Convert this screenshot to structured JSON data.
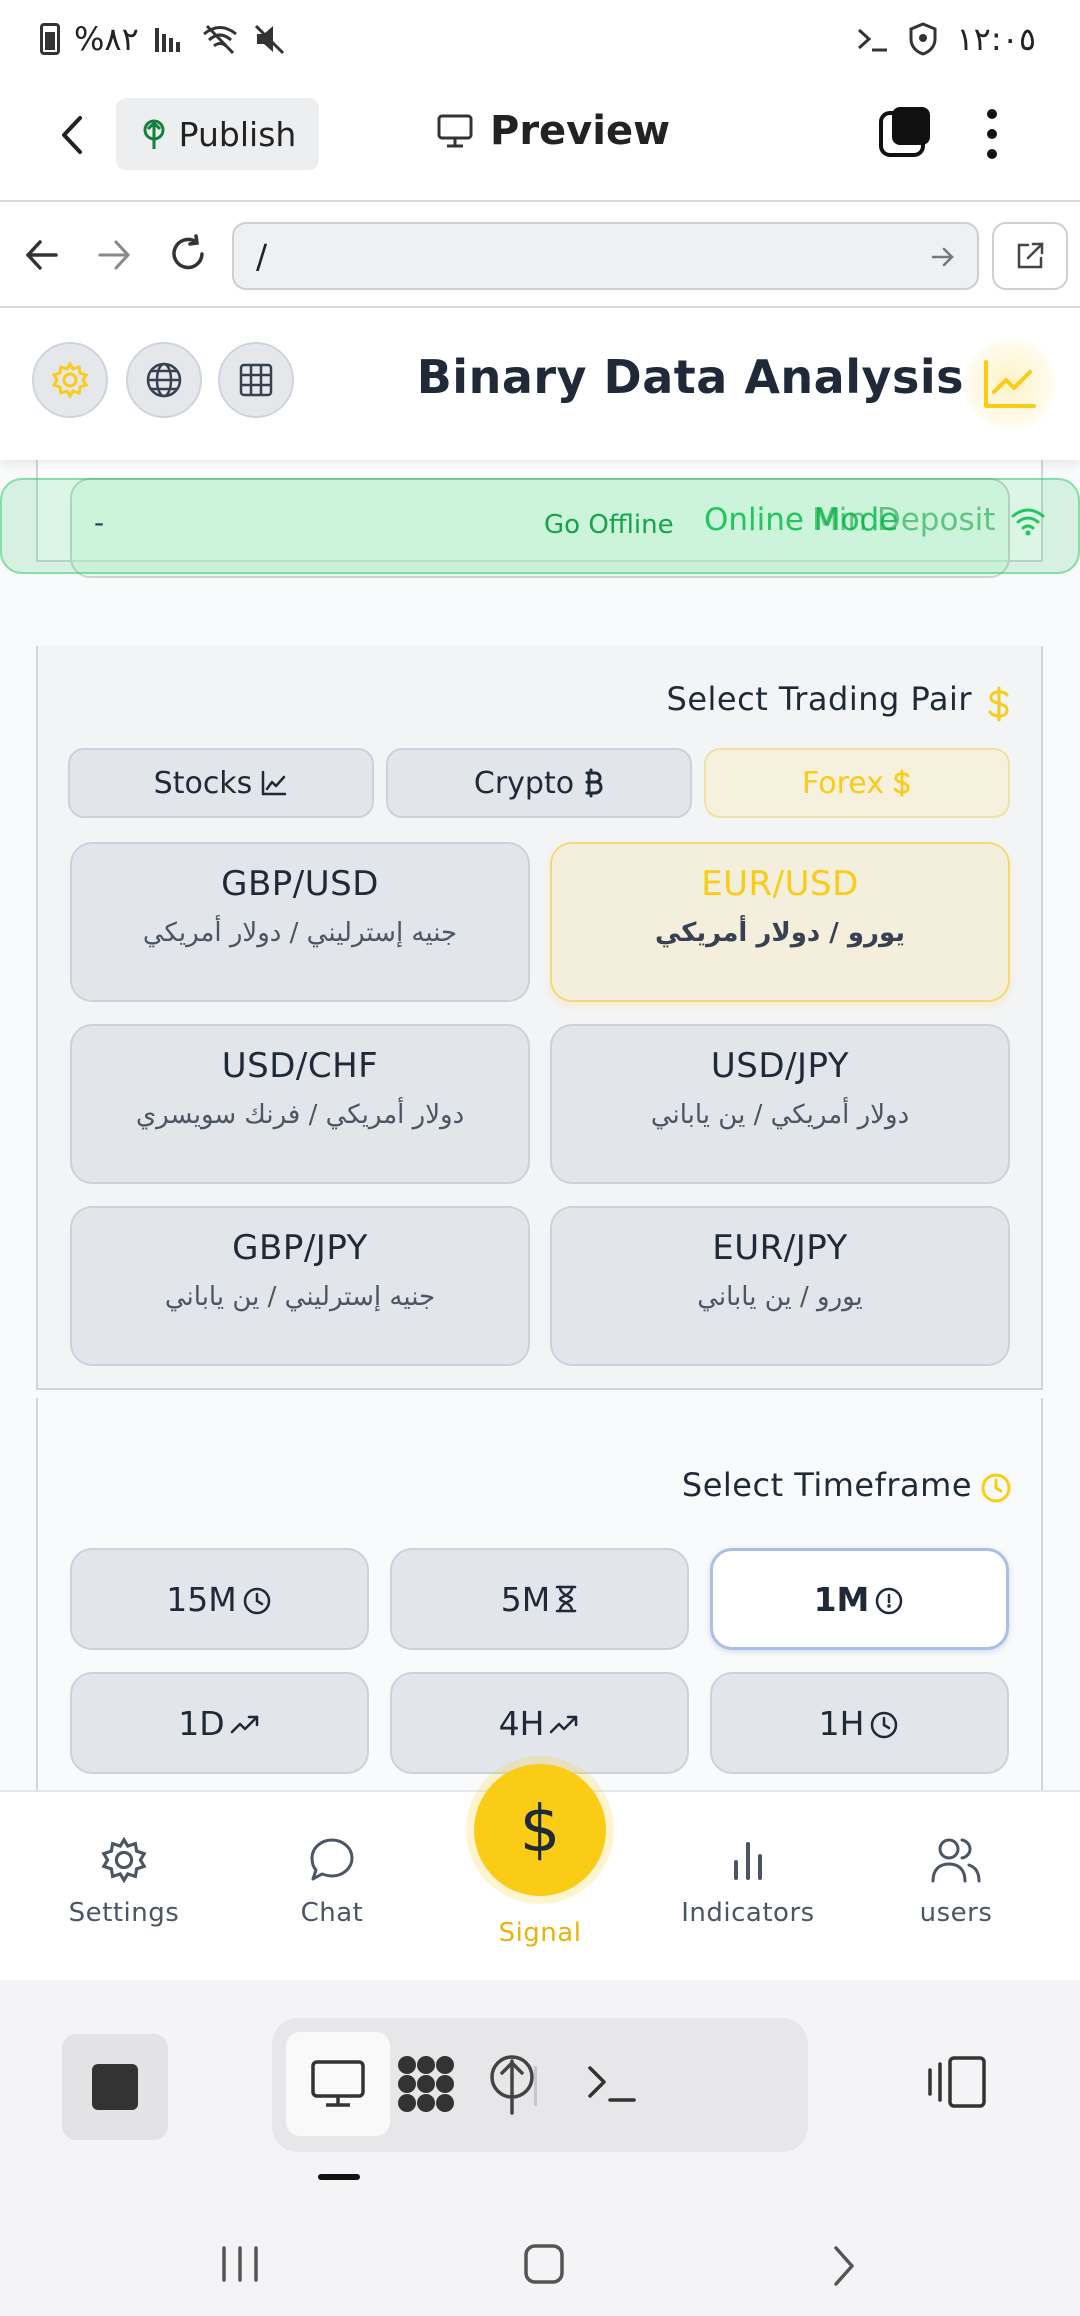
{
  "status_bar": {
    "battery_percent": "%٨٢",
    "time": "١٢:٠٥"
  },
  "topbar": {
    "publish_label": "Publish",
    "preview_label": "Preview"
  },
  "urlbar": {
    "url": "/"
  },
  "app": {
    "title": "Binary Data Analysis",
    "banner": {
      "dash": "-",
      "go_offline": "Go Offline",
      "online_mode": "Online Mode",
      "min_deposit": "Min Deposit"
    },
    "trading_pair": {
      "title": "Select Trading Pair",
      "tabs": [
        {
          "label": "Forex",
          "active": true
        },
        {
          "label": "Crypto",
          "active": false
        },
        {
          "label": "Stocks",
          "active": false
        }
      ],
      "pairs": [
        {
          "code": "EUR/USD",
          "name": "يورو / دولار أمريكي",
          "active": true
        },
        {
          "code": "GBP/USD",
          "name": "جنيه إسترليني / دولار أمريكي",
          "active": false
        },
        {
          "code": "USD/JPY",
          "name": "دولار أمريكي / ين ياباني",
          "active": false
        },
        {
          "code": "USD/CHF",
          "name": "دولار أمريكي / فرنك سويسري",
          "active": false
        },
        {
          "code": "EUR/JPY",
          "name": "يورو / ين ياباني",
          "active": false
        },
        {
          "code": "GBP/JPY",
          "name": "جنيه إسترليني / ين ياباني",
          "active": false
        }
      ]
    },
    "timeframe": {
      "title": "Select Timeframe",
      "options": [
        {
          "label": "1M",
          "icon": "alert-clock-icon",
          "active": true
        },
        {
          "label": "5M",
          "icon": "hourglass-icon",
          "active": false
        },
        {
          "label": "15M",
          "icon": "clock-icon",
          "active": false
        },
        {
          "label": "1H",
          "icon": "clock-icon",
          "active": false
        },
        {
          "label": "4H",
          "icon": "trend-up-icon",
          "active": false
        },
        {
          "label": "1D",
          "icon": "trend-up-icon",
          "active": false
        }
      ]
    }
  },
  "bottom_nav": {
    "settings": "Settings",
    "chat": "Chat",
    "signal": "Signal",
    "signal_symbol": "$",
    "indicators": "Indicators",
    "users": "users"
  },
  "colors": {
    "accent": "#facc15",
    "online_green": "#22c55e",
    "active_timeframe_border": "#a9bfe6"
  }
}
